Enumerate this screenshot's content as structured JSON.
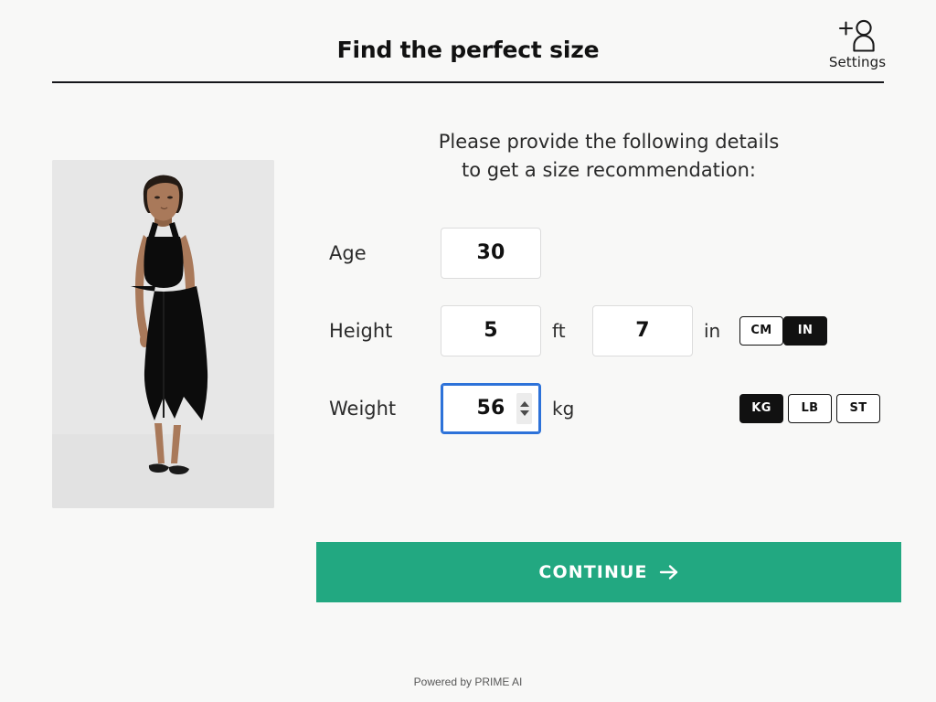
{
  "header": {
    "title": "Find the perfect size",
    "settings_label": "Settings",
    "settings_icon": "add-person-icon"
  },
  "product": {
    "image_alt": "black sleeveless jumpsuit on model",
    "background_color": "#e6e6e6"
  },
  "form": {
    "intro_line1": "Please provide the following details",
    "intro_line2": "to get a size recommendation:",
    "fields": [
      {
        "key": "age",
        "label": "Age",
        "value": "30",
        "suffix": "",
        "focused": false,
        "spinner": false
      },
      {
        "key": "height_ft",
        "label": "Height",
        "value": "5",
        "suffix": "ft",
        "focused": false,
        "spinner": false
      },
      {
        "key": "height_in",
        "label": "",
        "value": "7",
        "suffix": "in",
        "focused": false,
        "spinner": false
      },
      {
        "key": "weight",
        "label": "Weight",
        "value": "56",
        "suffix": "kg",
        "focused": true,
        "spinner": true
      }
    ],
    "height_units": {
      "options": [
        "CM",
        "IN"
      ],
      "selected": "IN"
    },
    "weight_units": {
      "options": [
        "KG",
        "LB",
        "ST"
      ],
      "selected": "KG"
    }
  },
  "continue": {
    "label": "CONTINUE",
    "arrow_icon": "arrow-right-icon",
    "color": "#22a881"
  },
  "footer": {
    "powered_by": "Powered by PRIME AI"
  }
}
